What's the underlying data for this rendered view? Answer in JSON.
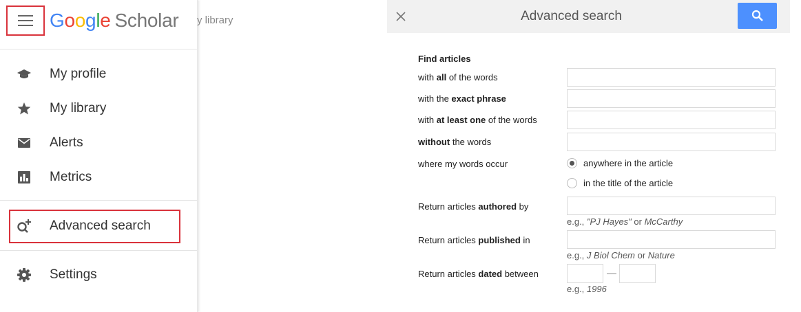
{
  "drawer": {
    "logo": {
      "G": "G",
      "o1": "o",
      "o2": "o",
      "g": "g",
      "l": "l",
      "e": "e",
      "scholar": "Scholar"
    },
    "items": [
      {
        "label": "My profile",
        "icon": "graduation-cap-icon"
      },
      {
        "label": "My library",
        "icon": "star-icon"
      },
      {
        "label": "Alerts",
        "icon": "envelope-icon"
      },
      {
        "label": "Metrics",
        "icon": "bar-chart-icon"
      },
      {
        "label": "Advanced search",
        "icon": "search-plus-icon"
      },
      {
        "label": "Settings",
        "icon": "gear-icon"
      }
    ],
    "highlight_color": "#d9323b"
  },
  "behind": {
    "partial_text": "y library"
  },
  "advanced": {
    "title": "Advanced search",
    "section_title": "Find articles",
    "all_words": {
      "pre": "with ",
      "bold": "all",
      "post": " of the words",
      "value": ""
    },
    "exact_phrase": {
      "pre": "with the ",
      "bold": "exact phrase",
      "post": "",
      "value": ""
    },
    "at_least_one": {
      "pre": "with ",
      "bold": "at least one",
      "post": " of the words",
      "value": ""
    },
    "without": {
      "pre": "",
      "bold": "without",
      "post": " the words",
      "value": ""
    },
    "occur_label": "where my words occur",
    "occur_options": [
      {
        "label": "anywhere in the article",
        "selected": true
      },
      {
        "label": "in the title of the article",
        "selected": false
      }
    ],
    "authored": {
      "pre": "Return articles ",
      "bold": "authored",
      "post": " by",
      "value": "",
      "hint_pre": "e.g., ",
      "hint_i1": "\"PJ Hayes\"",
      "hint_mid": " or ",
      "hint_i2": "McCarthy"
    },
    "published": {
      "pre": "Return articles ",
      "bold": "published",
      "post": " in",
      "value": "",
      "hint_pre": "e.g., ",
      "hint_i1": "J Biol Chem",
      "hint_mid": " or ",
      "hint_i2": "Nature"
    },
    "dated": {
      "pre": "Return articles ",
      "bold": "dated",
      "post": " between",
      "from": "",
      "to": "",
      "hint_pre": "e.g., ",
      "hint_i1": "1996"
    },
    "search_button_color": "#4d90fe"
  }
}
